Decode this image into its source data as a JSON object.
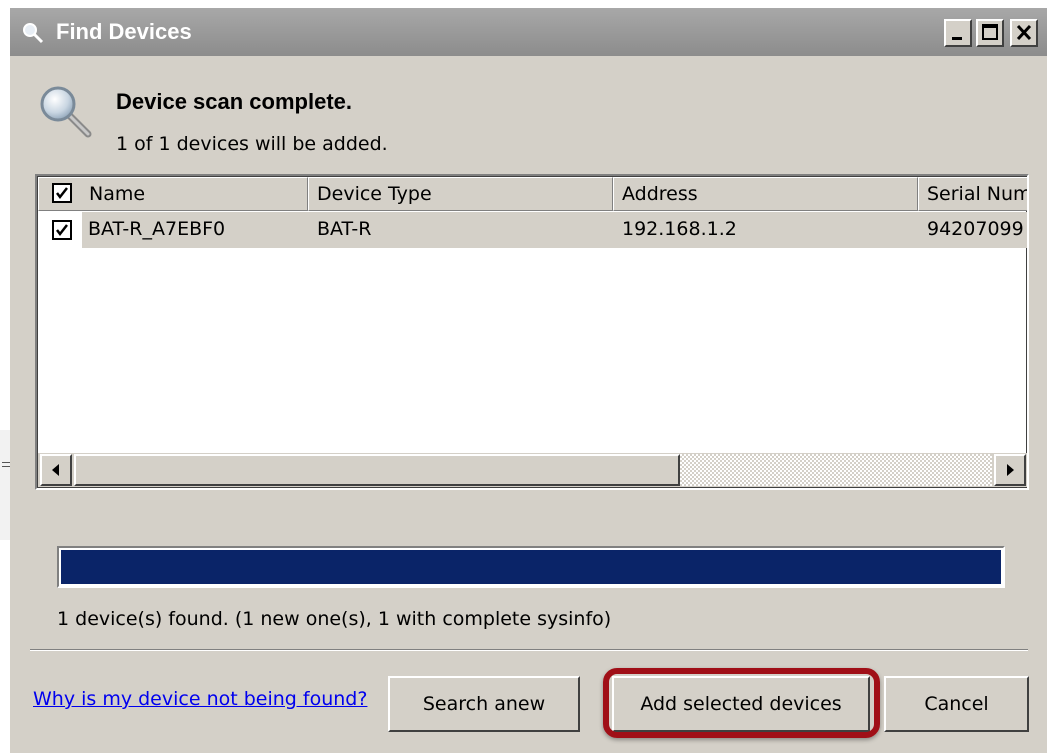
{
  "window": {
    "title": "Find Devices",
    "controls": [
      "minimize",
      "maximize",
      "close"
    ]
  },
  "scan": {
    "heading": "Device scan complete.",
    "subheading": "1 of 1 devices will be added."
  },
  "device_list": {
    "select_all_checked": true,
    "columns": [
      "Name",
      "Device Type",
      "Address",
      "Serial Num"
    ],
    "rows": [
      {
        "checked": true,
        "name": "BAT-R_A7EBF0",
        "device_type": "BAT-R",
        "address": "192.168.1.2",
        "serial": "94207099"
      }
    ]
  },
  "progress": {
    "fraction": 1.0,
    "color": "#0a2468"
  },
  "status_text": "1 device(s) found. (1 new one(s), 1 with complete sysinfo)",
  "footer": {
    "help_link": "Why is my device not being found?",
    "search_anew": "Search anew",
    "add_selected": "Add selected devices",
    "cancel": "Cancel"
  },
  "annotation": {
    "color": "#a00f17",
    "target": "Add selected devices"
  }
}
